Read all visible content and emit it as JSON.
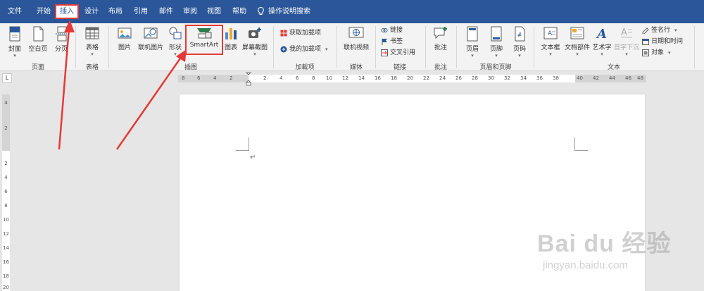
{
  "tabs": [
    {
      "label": "文件",
      "active": false
    },
    {
      "label": "开始",
      "active": false
    },
    {
      "label": "插入",
      "active": true
    },
    {
      "label": "设计",
      "active": false
    },
    {
      "label": "布局",
      "active": false
    },
    {
      "label": "引用",
      "active": false
    },
    {
      "label": "邮件",
      "active": false
    },
    {
      "label": "审阅",
      "active": false
    },
    {
      "label": "视图",
      "active": false
    },
    {
      "label": "帮助",
      "active": false
    }
  ],
  "tell_me": "操作说明搜索",
  "ribbon": {
    "pages": {
      "label": "页面",
      "cover": "封面",
      "blank": "空白页",
      "break": "分页"
    },
    "tables": {
      "label": "表格",
      "table": "表格"
    },
    "illustrations": {
      "label": "插图",
      "picture": "图片",
      "online_picture": "联机图片",
      "shapes": "形状",
      "smartart": "SmartArt",
      "chart": "图表",
      "screenshot": "屏幕截图"
    },
    "addins": {
      "label": "加载项",
      "get": "获取加载项",
      "my": "我的加载项"
    },
    "media": {
      "label": "媒体",
      "online_video": "联机视频"
    },
    "links": {
      "label": "链接",
      "link": "链接",
      "bookmark": "书签",
      "cross_ref": "交叉引用"
    },
    "comments": {
      "label": "批注",
      "comment": "批注"
    },
    "header_footer": {
      "label": "页眉和页脚",
      "header": "页眉",
      "footer": "页脚",
      "page_number": "页码"
    },
    "text": {
      "label": "文本",
      "textbox": "文本框",
      "quick_parts": "文档部件",
      "wordart": "艺术字",
      "dropcap": "首字下沉",
      "signature": "签名行",
      "datetime": "日期和时间",
      "object": "对象"
    }
  },
  "ruler_corner": "L",
  "ruler_numbers": [
    "8",
    "6",
    "4",
    "2",
    "2",
    "4",
    "6",
    "8",
    "10",
    "12",
    "14",
    "16",
    "18",
    "20",
    "22",
    "24",
    "26",
    "28",
    "30",
    "32",
    "34",
    "36",
    "38",
    "40",
    "42",
    "44",
    "46",
    "48"
  ],
  "vruler_numbers": [
    "4",
    "2",
    "2",
    "4",
    "6",
    "8",
    "10",
    "12",
    "14",
    "16",
    "18",
    "20"
  ],
  "paragraph_mark": "↵",
  "watermark": {
    "brand": "Bai du 经验",
    "url": "jingyan.baidu.com"
  },
  "colors": {
    "accent": "#2b579a",
    "highlight": "#e53935"
  }
}
